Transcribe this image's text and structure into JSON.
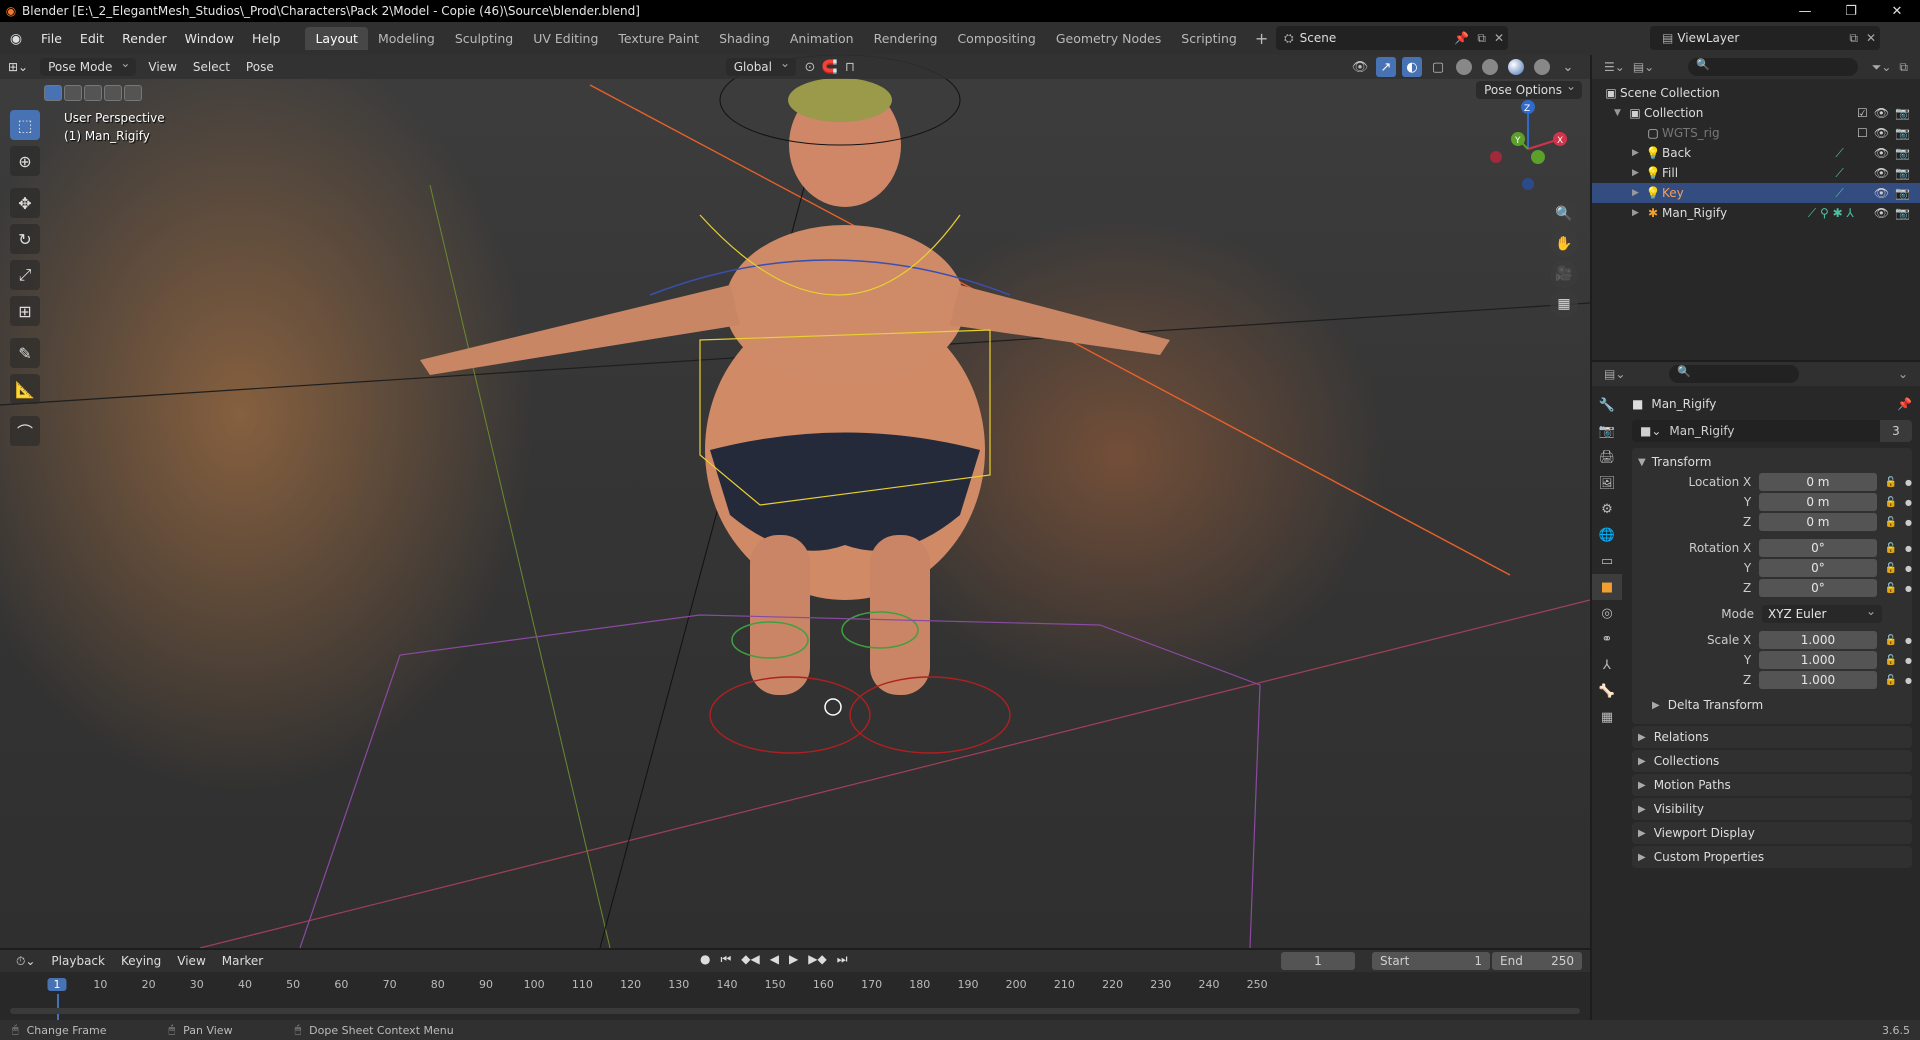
{
  "window": {
    "title": "Blender [E:\\_2_ElegantMesh_Studios\\_Prod\\Characters\\Pack 2\\Model - Copie (46)\\Source\\blender.blend]",
    "minimize": "—",
    "maximize": "❐",
    "close": "✕"
  },
  "menubar": {
    "items": [
      "File",
      "Edit",
      "Render",
      "Window",
      "Help"
    ],
    "workspaces": [
      "Layout",
      "Modeling",
      "Sculpting",
      "UV Editing",
      "Texture Paint",
      "Shading",
      "Animation",
      "Rendering",
      "Compositing",
      "Geometry Nodes",
      "Scripting"
    ],
    "active_workspace": "Layout",
    "scene": "Scene",
    "view_layer": "ViewLayer"
  },
  "viewport": {
    "mode": "Pose Mode",
    "menus": [
      "View",
      "Select",
      "Pose"
    ],
    "transform_orientation": "Global",
    "overlay_line1": "User Perspective",
    "overlay_line2": "(1) Man_Rigify",
    "pose_options": "Pose Options",
    "gizmo": {
      "x": "X",
      "y": "Y",
      "z": "Z"
    }
  },
  "outliner": {
    "rows": [
      {
        "name": "Scene Collection",
        "depth": 0,
        "icon": "scene-collection-icon",
        "style": "normal"
      },
      {
        "name": "Collection",
        "depth": 1,
        "icon": "collection-icon",
        "style": "normal"
      },
      {
        "name": "WGTS_rig",
        "depth": 2,
        "icon": "collection-icon",
        "style": "dim"
      },
      {
        "name": "Back",
        "depth": 2,
        "icon": "light-icon",
        "style": "normal"
      },
      {
        "name": "Fill",
        "depth": 2,
        "icon": "light-icon",
        "style": "normal"
      },
      {
        "name": "Key",
        "depth": 2,
        "icon": "light-icon",
        "style": "active"
      },
      {
        "name": "Man_Rigify",
        "depth": 2,
        "icon": "armature-icon",
        "style": "normal"
      }
    ]
  },
  "properties": {
    "object_name": "Man_Rigify",
    "data_name": "Man_Rigify",
    "data_users": "3",
    "transform_title": "Transform",
    "location": {
      "label": "Location X",
      "x": "0 m",
      "y": "0 m",
      "z": "0 m"
    },
    "rotation": {
      "label": "Rotation X",
      "x": "0°",
      "y": "0°",
      "z": "0°"
    },
    "mode_label": "Mode",
    "mode_value": "XYZ Euler",
    "scale": {
      "label": "Scale X",
      "x": "1.000",
      "y": "1.000",
      "z": "1.000"
    },
    "axis_y": "Y",
    "axis_z": "Z",
    "delta_transform": "Delta Transform",
    "panels": [
      "Relations",
      "Collections",
      "Motion Paths",
      "Visibility",
      "Viewport Display",
      "Custom Properties"
    ]
  },
  "timeline": {
    "menus": [
      "Playback",
      "Keying",
      "View",
      "Marker"
    ],
    "current_frame": "1",
    "start_label": "Start",
    "start_value": "1",
    "end_label": "End",
    "end_value": "250",
    "ticks": [
      "10",
      "20",
      "30",
      "40",
      "50",
      "60",
      "70",
      "80",
      "90",
      "100",
      "110",
      "120",
      "130",
      "140",
      "150",
      "160",
      "170",
      "180",
      "190",
      "200",
      "210",
      "220",
      "230",
      "240",
      "250"
    ]
  },
  "statusbar": {
    "items": [
      "Change Frame",
      "Pan View",
      "Dope Sheet Context Menu"
    ],
    "version": "3.6.5"
  },
  "colors": {
    "accent": "#4772b3",
    "active_object": "#f0a060",
    "light": "#f0a030"
  }
}
